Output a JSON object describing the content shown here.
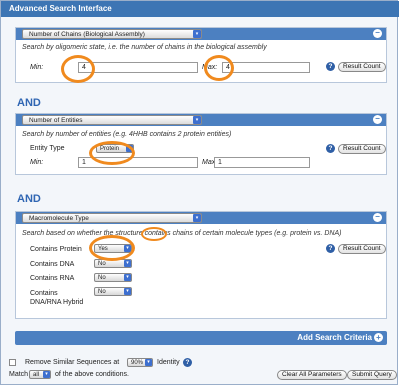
{
  "window": {
    "title": "Advanced Search Interface"
  },
  "panel1": {
    "dropdown": "Number of Chains (Biological Assembly)",
    "description": "Search by oligomeric state, i.e. the number of chains in the biological assembly",
    "min_label": "Min:",
    "min_value": "4",
    "max_label": "Max:",
    "max_value": "4",
    "result_button": "Result Count"
  },
  "and_label": "AND",
  "panel2": {
    "dropdown": "Number of Entities",
    "description": "Search by number of entities (e.g. 4HHB contains 2 protein entities)",
    "entity_type_label": "Entity Type",
    "entity_type_value": "Protein",
    "min_label": "Min:",
    "min_value": "1",
    "max_label": "Max:",
    "max_value": "1",
    "result_button": "Result Count"
  },
  "panel3": {
    "dropdown": "Macromolecule Type",
    "description": "Search based on whether the structure contains chains of certain molecule types (e.g. protein vs. DNA)",
    "rows": [
      {
        "label": "Contains Protein",
        "value": "Yes"
      },
      {
        "label": "Contains DNA",
        "value": "No"
      },
      {
        "label": "Contains RNA",
        "value": "No"
      },
      {
        "label": "Contains DNA/RNA Hybrid",
        "value": "No"
      }
    ],
    "result_button": "Result Count"
  },
  "add_criteria": "Add Search Criteria",
  "footer": {
    "remove_similar_label": "Remove Similar Sequences at",
    "identity_value": "90%",
    "identity_label": "Identity",
    "match_label": "Match",
    "match_value": "all",
    "match_suffix": "of the above conditions.",
    "clear_button": "Clear All Parameters",
    "submit_button": "Submit Query"
  },
  "colors": {
    "accent": "#4c80c1",
    "highlight": "#f08a1e",
    "and_text": "#3066b3"
  }
}
